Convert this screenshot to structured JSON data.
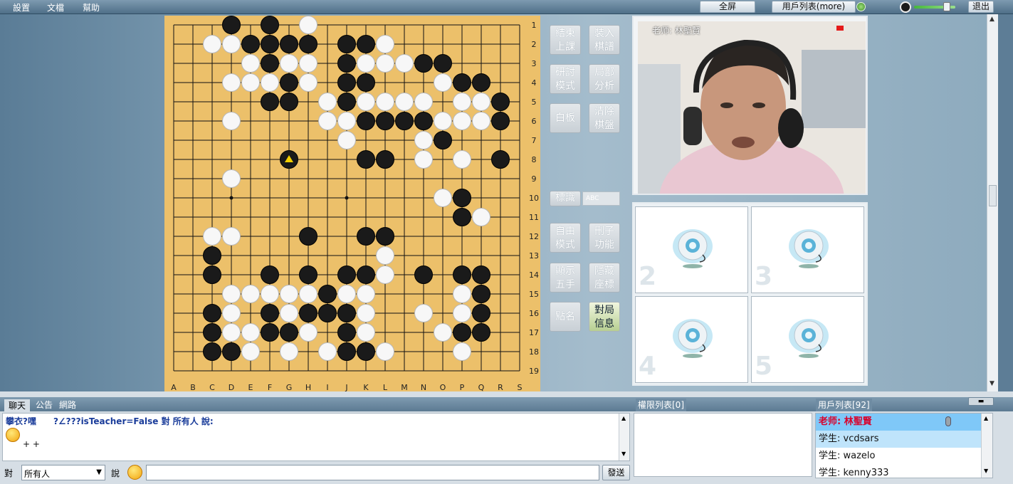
{
  "menu": {
    "settings": "設置",
    "file": "文檔",
    "help": "幫助"
  },
  "topbar": {
    "fullscreen": "全屏",
    "userlist": "用戶列表(more)",
    "exit": "退出"
  },
  "controls": [
    {
      "l1": "結束",
      "l2": "上課"
    },
    {
      "l1": "裝入",
      "l2": "棋譜"
    },
    {
      "l1": "研討",
      "l2": "模式"
    },
    {
      "l1": "局部",
      "l2": "分析"
    },
    {
      "l1": "白板",
      "l2": ""
    },
    {
      "l1": "清除",
      "l2": "棋盤"
    },
    {
      "l1": "自由",
      "l2": "模式"
    },
    {
      "l1": "刪子",
      "l2": "功能"
    },
    {
      "l1": "顯示",
      "l2": "五手"
    },
    {
      "l1": "隱藏",
      "l2": "座標"
    },
    {
      "l1": "點名",
      "l2": ""
    },
    {
      "l1": "對局",
      "l2": "信息"
    }
  ],
  "mark": {
    "label": "標識",
    "abc": "ABC"
  },
  "board": {
    "cols": [
      "A",
      "B",
      "C",
      "D",
      "E",
      "F",
      "G",
      "H",
      "I",
      "J",
      "K",
      "L",
      "M",
      "N",
      "O",
      "P",
      "Q",
      "R",
      "S"
    ],
    "rows": [
      "1",
      "2",
      "3",
      "4",
      "5",
      "6",
      "7",
      "8",
      "9",
      "10",
      "11",
      "12",
      "13",
      "14",
      "15",
      "16",
      "17",
      "18",
      "19"
    ],
    "black": [
      [
        3,
        0
      ],
      [
        5,
        0
      ],
      [
        4,
        1
      ],
      [
        5,
        1
      ],
      [
        6,
        1
      ],
      [
        7,
        1
      ],
      [
        9,
        1
      ],
      [
        10,
        1
      ],
      [
        5,
        2
      ],
      [
        9,
        2
      ],
      [
        13,
        2
      ],
      [
        14,
        2
      ],
      [
        6,
        3
      ],
      [
        9,
        3
      ],
      [
        10,
        3
      ],
      [
        15,
        3
      ],
      [
        16,
        3
      ],
      [
        5,
        4
      ],
      [
        6,
        4
      ],
      [
        9,
        4
      ],
      [
        17,
        4
      ],
      [
        10,
        5
      ],
      [
        11,
        5
      ],
      [
        12,
        5
      ],
      [
        13,
        5
      ],
      [
        17,
        5
      ],
      [
        14,
        6
      ],
      [
        10,
        7
      ],
      [
        11,
        7
      ],
      [
        17,
        7
      ],
      [
        15,
        9
      ],
      [
        15,
        10
      ],
      [
        7,
        11
      ],
      [
        10,
        11
      ],
      [
        11,
        11
      ],
      [
        2,
        12
      ],
      [
        2,
        13
      ],
      [
        5,
        13
      ],
      [
        7,
        13
      ],
      [
        9,
        13
      ],
      [
        10,
        13
      ],
      [
        13,
        13
      ],
      [
        15,
        13
      ],
      [
        16,
        13
      ],
      [
        8,
        14
      ],
      [
        16,
        14
      ],
      [
        2,
        15
      ],
      [
        5,
        15
      ],
      [
        7,
        15
      ],
      [
        8,
        15
      ],
      [
        9,
        15
      ],
      [
        16,
        15
      ],
      [
        2,
        16
      ],
      [
        5,
        16
      ],
      [
        6,
        16
      ],
      [
        9,
        16
      ],
      [
        15,
        16
      ],
      [
        16,
        16
      ],
      [
        2,
        17
      ],
      [
        3,
        17
      ],
      [
        9,
        17
      ],
      [
        10,
        17
      ]
    ],
    "white": [
      [
        7,
        0
      ],
      [
        2,
        1
      ],
      [
        3,
        1
      ],
      [
        11,
        1
      ],
      [
        4,
        2
      ],
      [
        6,
        2
      ],
      [
        7,
        2
      ],
      [
        10,
        2
      ],
      [
        11,
        2
      ],
      [
        12,
        2
      ],
      [
        3,
        3
      ],
      [
        4,
        3
      ],
      [
        5,
        3
      ],
      [
        7,
        3
      ],
      [
        14,
        3
      ],
      [
        8,
        4
      ],
      [
        10,
        4
      ],
      [
        11,
        4
      ],
      [
        12,
        4
      ],
      [
        13,
        4
      ],
      [
        15,
        4
      ],
      [
        16,
        4
      ],
      [
        3,
        5
      ],
      [
        8,
        5
      ],
      [
        9,
        5
      ],
      [
        14,
        5
      ],
      [
        15,
        5
      ],
      [
        16,
        5
      ],
      [
        9,
        6
      ],
      [
        13,
        6
      ],
      [
        13,
        7
      ],
      [
        15,
        7
      ],
      [
        3,
        8
      ],
      [
        14,
        9
      ],
      [
        16,
        10
      ],
      [
        2,
        11
      ],
      [
        3,
        11
      ],
      [
        11,
        12
      ],
      [
        11,
        13
      ],
      [
        3,
        14
      ],
      [
        4,
        14
      ],
      [
        5,
        14
      ],
      [
        6,
        14
      ],
      [
        7,
        14
      ],
      [
        9,
        14
      ],
      [
        10,
        14
      ],
      [
        15,
        14
      ],
      [
        3,
        15
      ],
      [
        6,
        15
      ],
      [
        10,
        15
      ],
      [
        13,
        15
      ],
      [
        15,
        15
      ],
      [
        3,
        16
      ],
      [
        4,
        16
      ],
      [
        7,
        16
      ],
      [
        10,
        16
      ],
      [
        14,
        16
      ],
      [
        4,
        17
      ],
      [
        6,
        17
      ],
      [
        8,
        17
      ],
      [
        11,
        17
      ],
      [
        15,
        17
      ]
    ],
    "last_move": [
      6,
      7
    ],
    "star_points": [
      [
        3,
        9
      ],
      [
        9,
        9
      ]
    ]
  },
  "video": {
    "teacher": "老师: 林聖賢"
  },
  "seats": [
    "2",
    "3",
    "4",
    "5"
  ],
  "panel_tabs": {
    "chat": "聊天",
    "notice": "公告",
    "network": "網路",
    "perm": "權限列表[0]",
    "users": "用戶列表[92]"
  },
  "chat": {
    "line1": "攀衣?嘿　　?∠???isTeacher=False 對 所有人 說:",
    "line2": "+ +"
  },
  "users": [
    {
      "role": "老师: 林聖賢",
      "teacher": true
    },
    {
      "role": "学生: vcdsars",
      "teacher": false
    },
    {
      "role": "学生: wazelo",
      "teacher": false
    },
    {
      "role": "学生: kenny333",
      "teacher": false
    }
  ],
  "input": {
    "to_label": "對",
    "target": "所有人",
    "say_label": "說",
    "send": "發送"
  }
}
